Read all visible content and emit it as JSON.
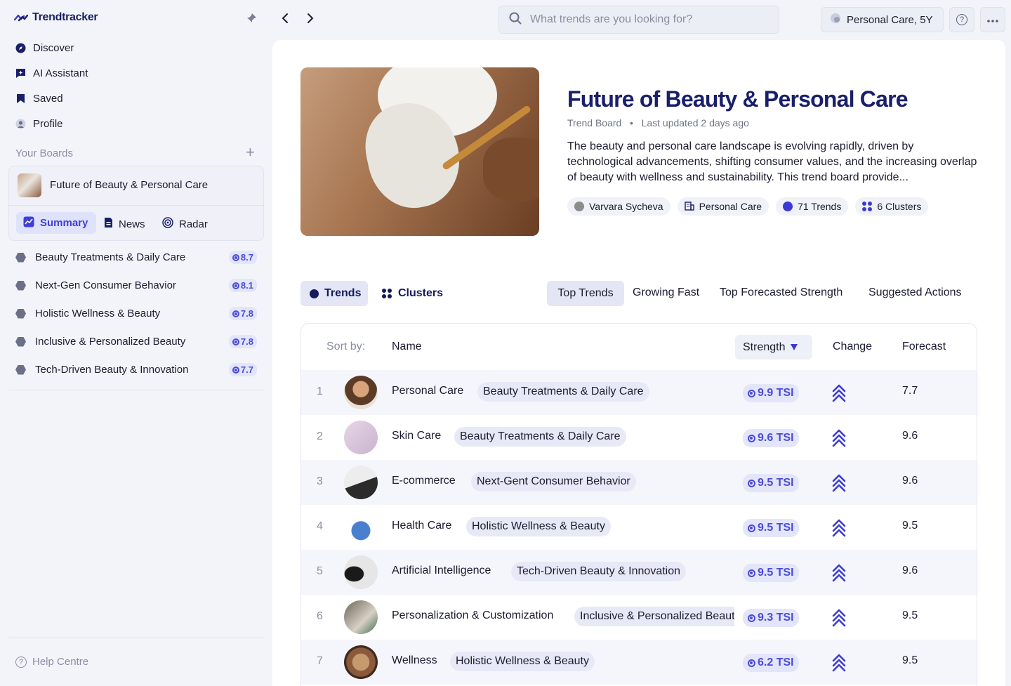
{
  "app": {
    "name": "Trendtracker"
  },
  "nav": [
    {
      "label": "Discover",
      "icon": "compass-icon"
    },
    {
      "label": "AI Assistant",
      "icon": "ai-chat-icon"
    },
    {
      "label": "Saved",
      "icon": "bookmark-icon"
    },
    {
      "label": "Profile",
      "icon": "user-icon"
    }
  ],
  "boards": {
    "heading": "Your Boards",
    "active": {
      "title": "Future of Beauty & Personal Care",
      "tabs": [
        "Summary",
        "News",
        "Radar"
      ]
    },
    "clusters": [
      {
        "label": "Beauty Treatments & Daily Care",
        "score": "8.7"
      },
      {
        "label": "Next-Gen Consumer Behavior",
        "score": "8.1"
      },
      {
        "label": "Holistic Wellness & Beauty",
        "score": "7.8"
      },
      {
        "label": "Inclusive & Personalized Beauty",
        "score": "7.8"
      },
      {
        "label": "Tech-Driven Beauty & Innovation",
        "score": "7.7"
      }
    ]
  },
  "help": {
    "label": "Help Centre"
  },
  "topbar": {
    "search_placeholder": "What trends are you looking for?",
    "scope": "Personal Care, 5Y"
  },
  "board": {
    "title": "Future of Beauty & Personal Care",
    "type": "Trend Board",
    "updated": "Last updated 2 days ago",
    "description": "The beauty and personal care landscape is evolving rapidly, driven by technological advancements, shifting consumer values, and the increasing overlap of beauty with wellness and sustainability. This trend board provide...",
    "chips": {
      "author": "Varvara Sycheva",
      "industry": "Personal Care",
      "trends": "71 Trends",
      "clusters": "6 Clusters"
    }
  },
  "view_tabs": {
    "trends": "Trends",
    "clusters": "Clusters"
  },
  "filter_tabs": [
    "Top Trends",
    "Growing Fast",
    "Top Forecasted Strength",
    "Suggested Actions"
  ],
  "table": {
    "sort_label": "Sort by:",
    "columns": {
      "name": "Name",
      "strength": "Strength",
      "change": "Change",
      "forecast": "Forecast"
    },
    "rows": [
      {
        "rank": "1",
        "name": "Personal Care",
        "cluster": "Beauty Treatments & Daily Care",
        "tsi": "9.9 TSI",
        "forecast": "7.7"
      },
      {
        "rank": "2",
        "name": "Skin Care",
        "cluster": "Beauty Treatments & Daily Care",
        "tsi": "9.6 TSI",
        "forecast": "9.6"
      },
      {
        "rank": "3",
        "name": "E-commerce",
        "cluster": "Next-Gent Consumer Behavior",
        "tsi": "9.5 TSI",
        "forecast": "9.6"
      },
      {
        "rank": "4",
        "name": "Health Care",
        "cluster": "Holistic Wellness & Beauty",
        "tsi": "9.5 TSI",
        "forecast": "9.5"
      },
      {
        "rank": "5",
        "name": "Artificial Intelligence",
        "cluster": "Tech-Driven Beauty & Innovation",
        "tsi": "9.5 TSI",
        "forecast": "9.6"
      },
      {
        "rank": "6",
        "name": "Personalization & Customization",
        "cluster": "Inclusive & Personalized Beauty",
        "tsi": "9.3 TSI",
        "forecast": "9.5"
      },
      {
        "rank": "7",
        "name": "Wellness",
        "cluster": "Holistic Wellness & Beauty",
        "tsi": "6.2 TSI",
        "forecast": "9.5"
      }
    ]
  },
  "colors": {
    "accent": "#3a3ad6",
    "navy": "#1a1f6b",
    "badge_bg": "#e3e5fb"
  }
}
